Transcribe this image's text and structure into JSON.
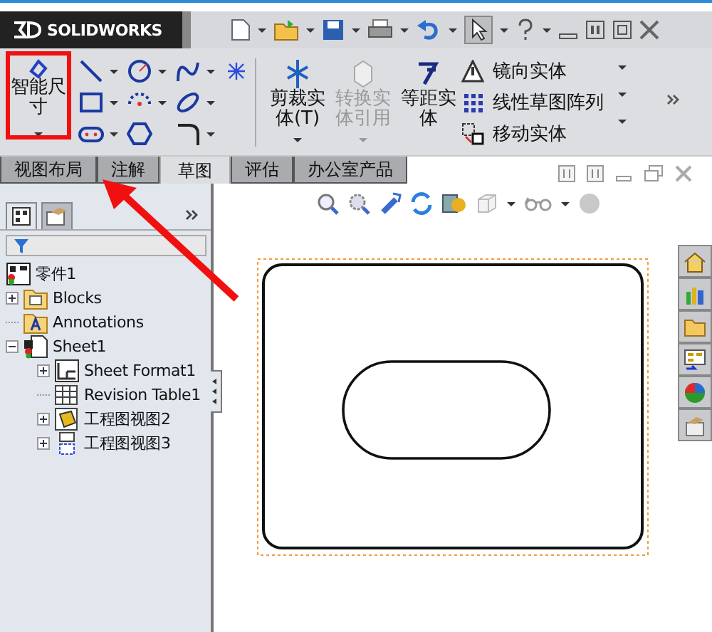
{
  "window": {
    "logo_text": "SOLIDWORKS"
  },
  "ribbon": {
    "smart_dimension": {
      "label": "智能尺寸"
    },
    "commands": [
      {
        "label": "剪裁实体(T)",
        "disabled": false
      },
      {
        "label": "转换实体引用",
        "disabled": true
      },
      {
        "label": "等距实体",
        "disabled": false
      }
    ],
    "list_commands": [
      {
        "label": "镜向实体",
        "kind": "mirror"
      },
      {
        "label": "线性草图阵列",
        "kind": "pattern"
      },
      {
        "label": "移动实体",
        "kind": "move"
      }
    ]
  },
  "tabs": [
    {
      "label": "视图布局",
      "selected": false
    },
    {
      "label": "注解",
      "selected": false
    },
    {
      "label": "草图",
      "selected": true
    },
    {
      "label": "评估",
      "selected": false
    },
    {
      "label": "办公室产品",
      "selected": false
    }
  ],
  "feature_tree": {
    "root": {
      "label": "零件1",
      "kind": "part",
      "children": [
        {
          "label": "Blocks",
          "kind": "folder",
          "expanded": false
        },
        {
          "label": "Annotations",
          "kind": "annotations"
        },
        {
          "label": "Sheet1",
          "kind": "sheet",
          "expanded": true,
          "children": [
            {
              "label": "Sheet Format1",
              "kind": "format",
              "expanded": false
            },
            {
              "label": "Revision Table1",
              "kind": "table"
            },
            {
              "label": "工程图视图2",
              "kind": "view",
              "expanded": false
            },
            {
              "label": "工程图视图3",
              "kind": "view3",
              "expanded": false
            }
          ]
        }
      ]
    }
  }
}
